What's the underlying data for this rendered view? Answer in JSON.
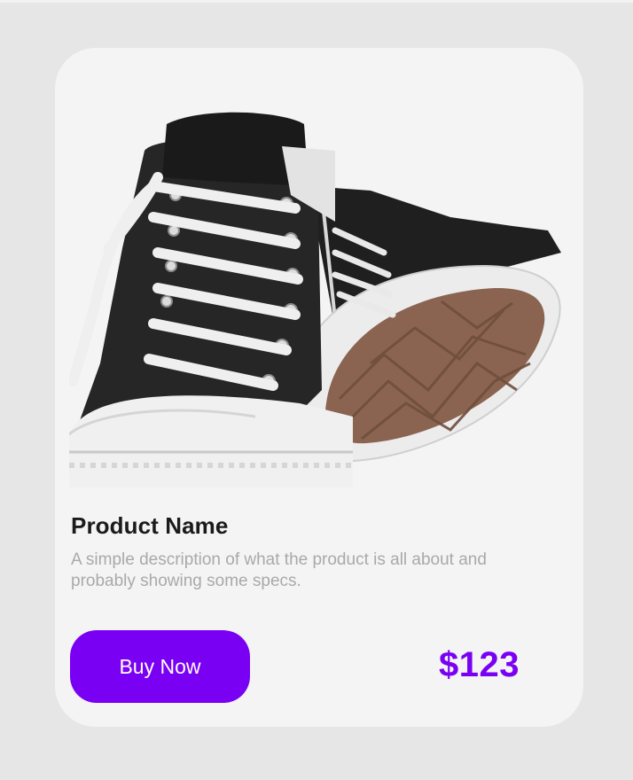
{
  "product": {
    "title": "Product Name",
    "description": "A simple description of what the product is all about and probably showing some specs.",
    "price": "$123",
    "buy_label": "Buy Now",
    "image_subject": "black high-top canvas sneakers"
  },
  "colors": {
    "accent": "#7a00f4",
    "card_background": "#f4f4f4",
    "page_background": "#e6e6e6",
    "title_text": "#1b1b1b",
    "description_text": "#a9a9a9"
  }
}
